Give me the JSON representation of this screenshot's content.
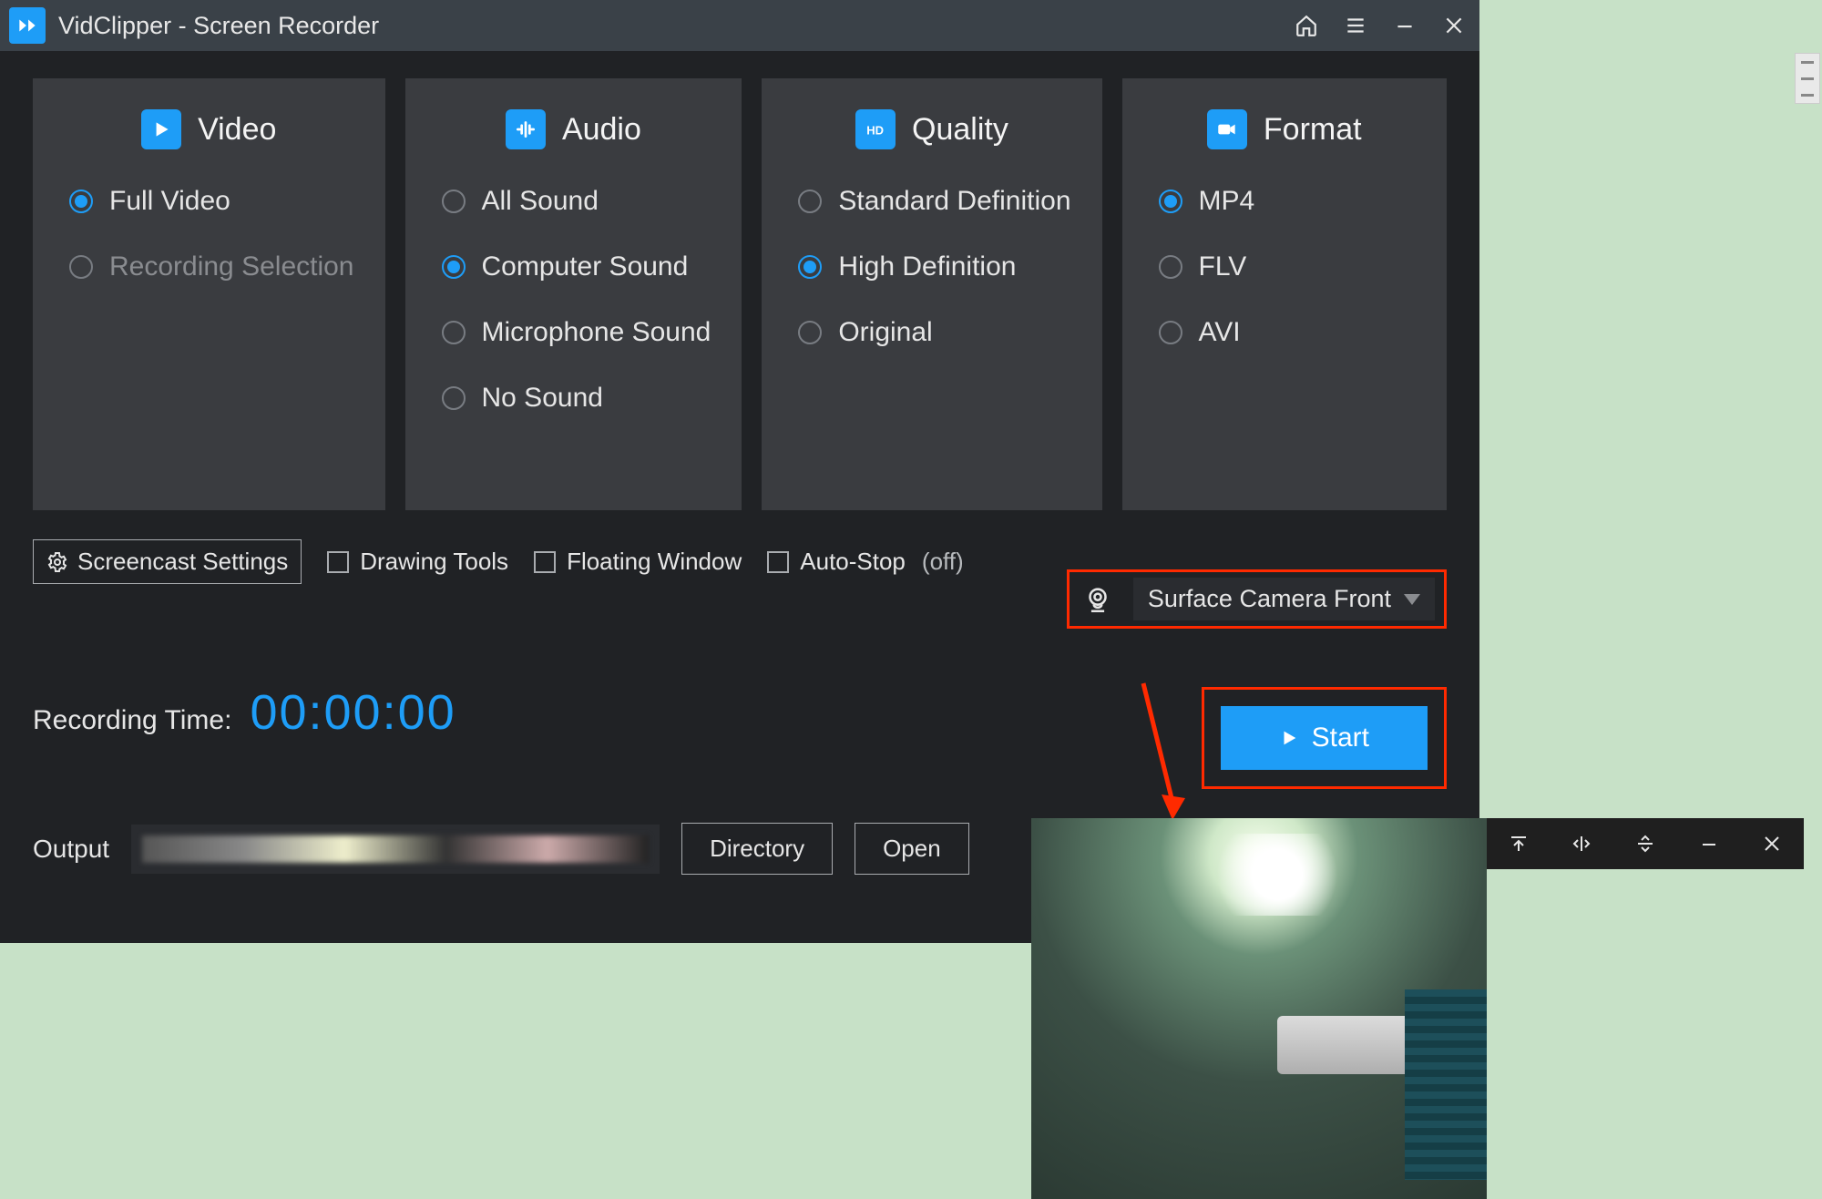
{
  "titlebar": {
    "appTitle": "VidClipper - Screen Recorder"
  },
  "panels": {
    "video": {
      "title": "Video",
      "options": [
        {
          "label": "Full Video",
          "selected": true
        },
        {
          "label": "Recording Selection",
          "selected": false,
          "muted": true
        }
      ]
    },
    "audio": {
      "title": "Audio",
      "options": [
        {
          "label": "All Sound",
          "selected": false
        },
        {
          "label": "Computer Sound",
          "selected": true
        },
        {
          "label": "Microphone Sound",
          "selected": false
        },
        {
          "label": "No Sound",
          "selected": false
        }
      ]
    },
    "quality": {
      "title": "Quality",
      "options": [
        {
          "label": "Standard Definition",
          "selected": false
        },
        {
          "label": "High Definition",
          "selected": true
        },
        {
          "label": "Original",
          "selected": false
        }
      ]
    },
    "format": {
      "title": "Format",
      "options": [
        {
          "label": "MP4",
          "selected": true
        },
        {
          "label": "FLV",
          "selected": false
        },
        {
          "label": "AVI",
          "selected": false
        }
      ]
    }
  },
  "toolbar": {
    "screencast": "Screencast Settings",
    "drawing": "Drawing Tools",
    "floating": "Floating Window",
    "autostop": "Auto-Stop",
    "autostop_state": "(off)",
    "camera_dropdown": "Surface Camera Front"
  },
  "recording": {
    "label": "Recording Time:",
    "time": "00:00:00",
    "start": "Start"
  },
  "output": {
    "label": "Output",
    "dir_btn": "Directory",
    "open_btn": "Open"
  }
}
